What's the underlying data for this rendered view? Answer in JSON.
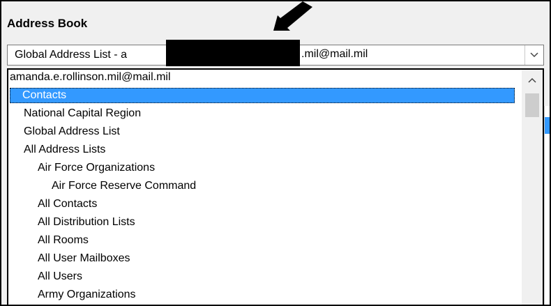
{
  "section_label": "Address Book",
  "combo": {
    "prefix": "Global Address List - a",
    "suffix": ".mil@mail.mil"
  },
  "dropdown": {
    "header": "amanda.e.rollinson.mil@mail.mil",
    "items": [
      {
        "label": "Contacts"
      },
      {
        "label": "National Capital Region"
      },
      {
        "label": "Global Address List"
      },
      {
        "label": "All Address Lists"
      },
      {
        "label": "Air Force Organizations"
      },
      {
        "label": "Air Force Reserve Command"
      },
      {
        "label": "All Contacts"
      },
      {
        "label": "All Distribution Lists"
      },
      {
        "label": "All Rooms"
      },
      {
        "label": "All User Mailboxes"
      },
      {
        "label": "All Users"
      },
      {
        "label": "Army Organizations"
      }
    ]
  },
  "icons": {
    "combo_button": "chevron-down-icon",
    "scroll_up": "chevron-up-icon",
    "annotation": "arrow-icon"
  },
  "colors": {
    "selection": "#3399ff"
  }
}
